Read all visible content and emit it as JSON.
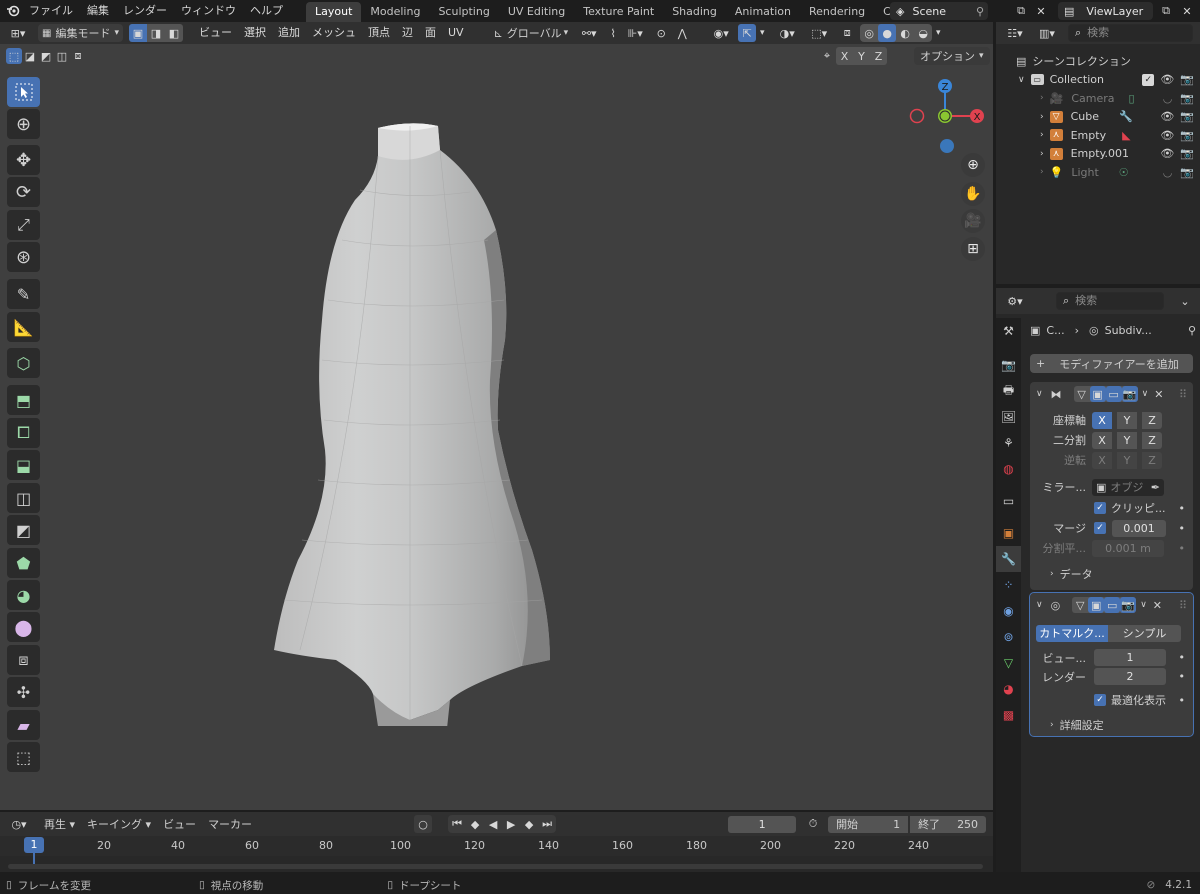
{
  "topbar": {
    "menus": [
      "ファイル",
      "編集",
      "レンダー",
      "ウィンドウ",
      "ヘルプ"
    ],
    "workspaces": [
      "Layout",
      "Modeling",
      "Sculpting",
      "UV Editing",
      "Texture Paint",
      "Shading",
      "Animation",
      "Rendering",
      "Compositi"
    ],
    "active_workspace": "Layout",
    "scene": "Scene",
    "view_layer": "ViewLayer"
  },
  "viewport_header": {
    "mode": "編集モード",
    "menus": [
      "ビュー",
      "選択",
      "追加",
      "メッシュ",
      "頂点",
      "辺",
      "面",
      "UV"
    ],
    "orientation": "グローバル",
    "axes": [
      "X",
      "Y",
      "Z"
    ],
    "options": "オプション"
  },
  "gizmo": {
    "x": "X",
    "y": "Y",
    "z": "Z"
  },
  "outliner": {
    "search_placeholder": "検索",
    "root": "シーンコレクション",
    "collection": "Collection",
    "items": [
      {
        "name": "Camera",
        "dimmed": true
      },
      {
        "name": "Cube",
        "dimmed": false
      },
      {
        "name": "Empty",
        "dimmed": false
      },
      {
        "name": "Empty.001",
        "dimmed": false
      },
      {
        "name": "Light",
        "dimmed": true
      }
    ]
  },
  "properties": {
    "search_placeholder": "検索",
    "breadcrumb_object": "C...",
    "breadcrumb_modifier": "Subdiv...",
    "add_modifier": "モディファイアーを追加",
    "mirror": {
      "axis_label": "座標軸",
      "bisect_label": "二分割",
      "flip_label": "逆転",
      "axes": [
        "X",
        "Y",
        "Z"
      ],
      "mirror_object_label": "ミラー...",
      "mirror_object_placeholder": "オブジ",
      "clipping_label": "クリッピ...",
      "merge_label": "マージ",
      "merge_value": "0.001",
      "bisect_distance_label": "分割平...",
      "bisect_distance_value": "0.001 m",
      "data_label": "データ"
    },
    "subdivision": {
      "catmull": "カトマルク...",
      "simple": "シンプル",
      "viewport_label": "ビュー...",
      "viewport_value": "1",
      "render_label": "レンダー",
      "render_value": "2",
      "optimal_label": "最適化表示",
      "advanced_label": "詳細設定"
    }
  },
  "timeline": {
    "menus": [
      "再生",
      "キーイング",
      "ビュー",
      "マーカー"
    ],
    "current_frame": "1",
    "start_label": "開始",
    "start_value": "1",
    "end_label": "終了",
    "end_value": "250",
    "ticks": [
      "20",
      "40",
      "60",
      "80",
      "100",
      "120",
      "140",
      "160",
      "180",
      "200",
      "220",
      "240"
    ],
    "playhead": "1"
  },
  "statusbar": {
    "hint1": "フレームを変更",
    "hint2": "視点の移動",
    "hint3": "ドープシート",
    "version": "4.2.1"
  },
  "colors": {
    "accent": "#4772b3",
    "axis_x": "#e0424f",
    "axis_y": "#8ac731",
    "axis_z": "#3a86d9"
  }
}
